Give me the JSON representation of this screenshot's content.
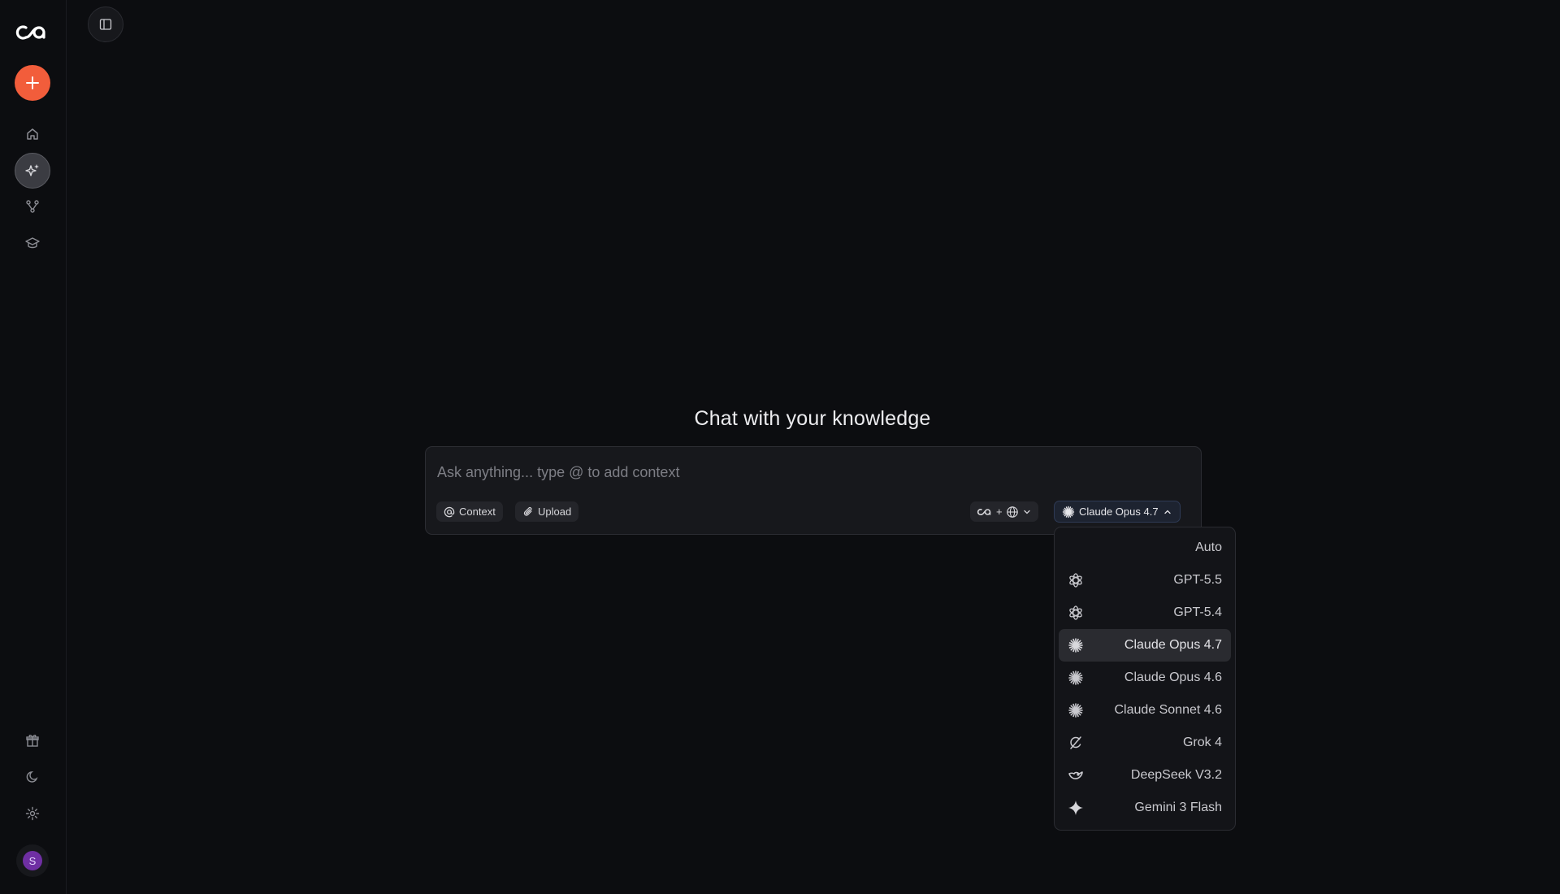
{
  "sidebar": {
    "avatar_initial": "S"
  },
  "main": {
    "title": "Chat with your knowledge"
  },
  "composer": {
    "placeholder": "Ask anything... type @ to add context",
    "context_label": "Context",
    "upload_label": "Upload",
    "source_plus": "+",
    "model_label": "Claude Opus 4.7"
  },
  "model_menu": {
    "items": [
      {
        "label": "Auto",
        "icon": "none"
      },
      {
        "label": "GPT-5.5",
        "icon": "openai-icon"
      },
      {
        "label": "GPT-5.4",
        "icon": "openai-icon"
      },
      {
        "label": "Claude Opus 4.7",
        "icon": "claude-icon",
        "selected": true
      },
      {
        "label": "Claude Opus 4.6",
        "icon": "claude-icon"
      },
      {
        "label": "Claude Sonnet 4.6",
        "icon": "claude-icon"
      },
      {
        "label": "Grok 4",
        "icon": "grok-icon"
      },
      {
        "label": "DeepSeek V3.2",
        "icon": "deepseek-icon"
      },
      {
        "label": "Gemini 3 Flash",
        "icon": "gemini-icon"
      }
    ]
  },
  "colors": {
    "background": "#0c0d10",
    "accent": "#f25d3b",
    "avatar": "#6f2fa3"
  }
}
